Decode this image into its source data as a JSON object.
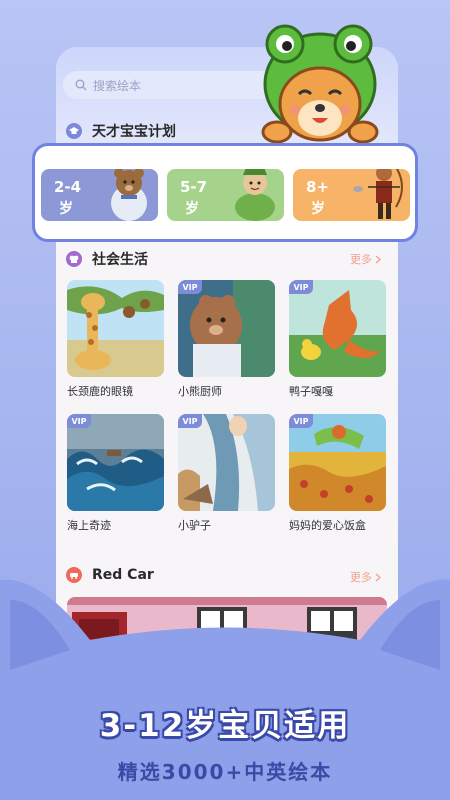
{
  "search": {
    "placeholder": "搜索绘本"
  },
  "plan": {
    "title": "天才宝宝计划",
    "ages": [
      {
        "range": "2-4",
        "unit": "岁",
        "color": "#8c99d6"
      },
      {
        "range": "5-7",
        "unit": "岁",
        "color": "#a6d38c"
      },
      {
        "range": "8+",
        "unit": "岁",
        "color": "#f7b367"
      }
    ]
  },
  "social": {
    "title": "社会生活",
    "more": "更多",
    "books": [
      {
        "title": "长颈鹿的眼镜",
        "vip": false
      },
      {
        "title": "小熊厨师",
        "vip": true
      },
      {
        "title": "鸭子嘎嘎",
        "vip": true
      },
      {
        "title": "海上奇迹",
        "vip": true
      },
      {
        "title": "小驴子",
        "vip": true
      },
      {
        "title": "妈妈的爱心饭盒",
        "vip": true
      }
    ],
    "vip_label": "VIP"
  },
  "redcar": {
    "title": "Red Car",
    "more": "更多"
  },
  "promo": {
    "headline": "3-12岁宝贝适用",
    "subline": "精选3000+中英绘本"
  }
}
